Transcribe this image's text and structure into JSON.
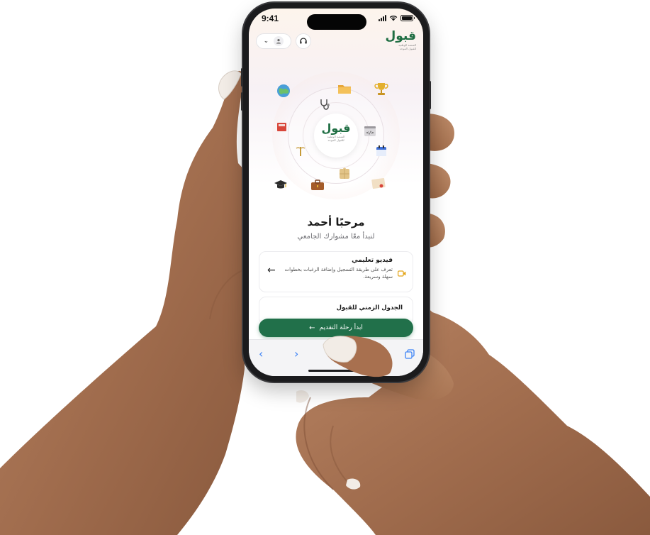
{
  "status_bar": {
    "time": "9:41"
  },
  "header": {
    "brand_name": "قبول",
    "brand_tagline_1": "المنصة الوطنية",
    "brand_tagline_2": "للقبول الموحد"
  },
  "hero": {
    "center_brand": "قبول",
    "center_tagline_1": "المنصة الوطنية",
    "center_tagline_2": "للقبول الموحد",
    "icons": [
      "globe-icon",
      "folder-icon",
      "trophy-icon",
      "stethoscope-icon",
      "book-icon",
      "code-icon",
      "caduceus-icon",
      "calendar-icon",
      "graduation-cap-icon",
      "briefcase-icon",
      "puzzle-icon",
      "certificate-icon"
    ]
  },
  "welcome": {
    "title": "مرحبًا أحمد",
    "subtitle": "لنبدأ معًا مشوارك الجامعي"
  },
  "video_card": {
    "title": "فيديو تعليمي",
    "description": "تعرف على طريقة التسجيل وإضافة الرغبات بخطوات سهلة وسريعة."
  },
  "timeline_card": {
    "title": "الجدول الزمني للقبول"
  },
  "cta": {
    "label": "ابدأ رحلة التقديم"
  },
  "colors": {
    "brand_green": "#21704a",
    "browser_blue": "#3b82f6"
  }
}
